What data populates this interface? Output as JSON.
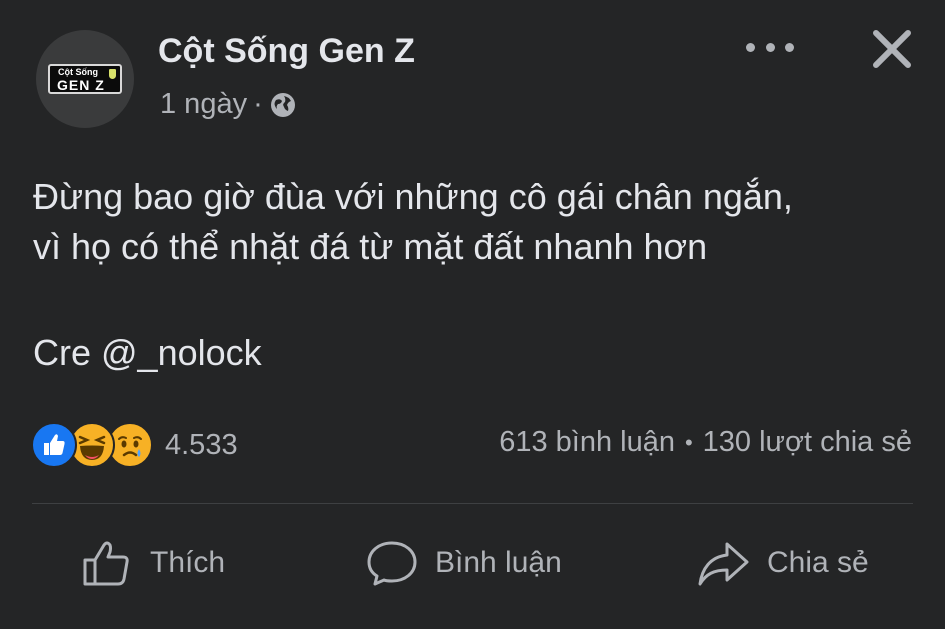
{
  "post": {
    "page_name": "Cột Sống Gen Z",
    "time": "1 ngày",
    "separator": "·",
    "logo_line1": "Cột Sống",
    "logo_line2": "GEN Z",
    "text_line1": "Đừng bao giờ đùa với những cô gái chân ngắn,",
    "text_line2": "vì họ có thể nhặt đá từ mặt đất nhanh hơn",
    "credit": "Cre @_nolock"
  },
  "engagement": {
    "reaction_count": "4.533",
    "comments": "613 bình luận",
    "bullet": "•",
    "shares": "130 lượt chia sẻ",
    "reaction_icons": [
      "like-icon",
      "haha-icon",
      "sad-icon"
    ]
  },
  "actions": {
    "like": "Thích",
    "comment": "Bình luận",
    "share": "Chia sẻ"
  },
  "colors": {
    "background": "#242526",
    "text": "#e4e6eb",
    "secondary": "#b0b3b8",
    "like_blue": "#1877f2",
    "emoji_yellow": "#f7b125"
  }
}
